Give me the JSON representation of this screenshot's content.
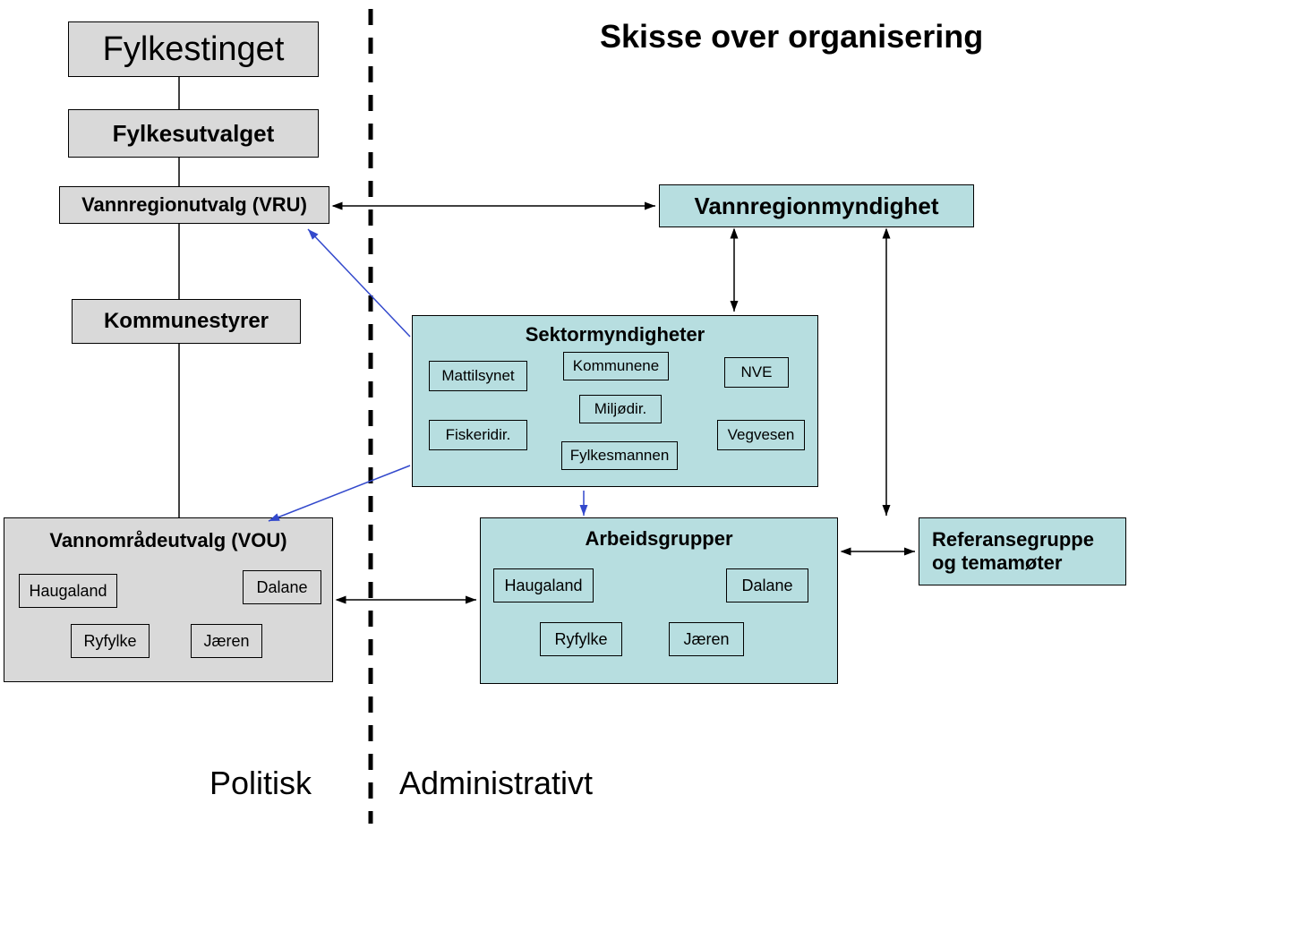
{
  "title": "Skisse over organisering",
  "politisk": {
    "fylkestinget": "Fylkestinget",
    "fylkesutvalget": "Fylkesutvalget",
    "vru": "Vannregionutvalg (VRU)",
    "kommunestyrer": "Kommunestyrer",
    "vou_title": "Vannområdeutvalg (VOU)",
    "vou_items": {
      "haugaland": "Haugaland",
      "dalane": "Dalane",
      "ryfylke": "Ryfylke",
      "jaeren": "Jæren"
    }
  },
  "administrativt": {
    "vrm": "Vannregionmyndighet",
    "sektor_title": "Sektormyndigheter",
    "sektor_items": {
      "mattilsynet": "Mattilsynet",
      "kommunene": "Kommunene",
      "nve": "NVE",
      "miljodir": "Miljødir.",
      "fiskeridir": "Fiskeridir.",
      "fylkesmannen": "Fylkesmannen",
      "vegvesen": "Vegvesen"
    },
    "arbeids_title": "Arbeidsgrupper",
    "arbeids_items": {
      "haugaland": "Haugaland",
      "dalane": "Dalane",
      "ryfylke": "Ryfylke",
      "jaeren": "Jæren"
    },
    "ref": "Referansegruppe og temamøter"
  },
  "labels": {
    "politisk": "Politisk",
    "administrativt": "Administrativt"
  }
}
